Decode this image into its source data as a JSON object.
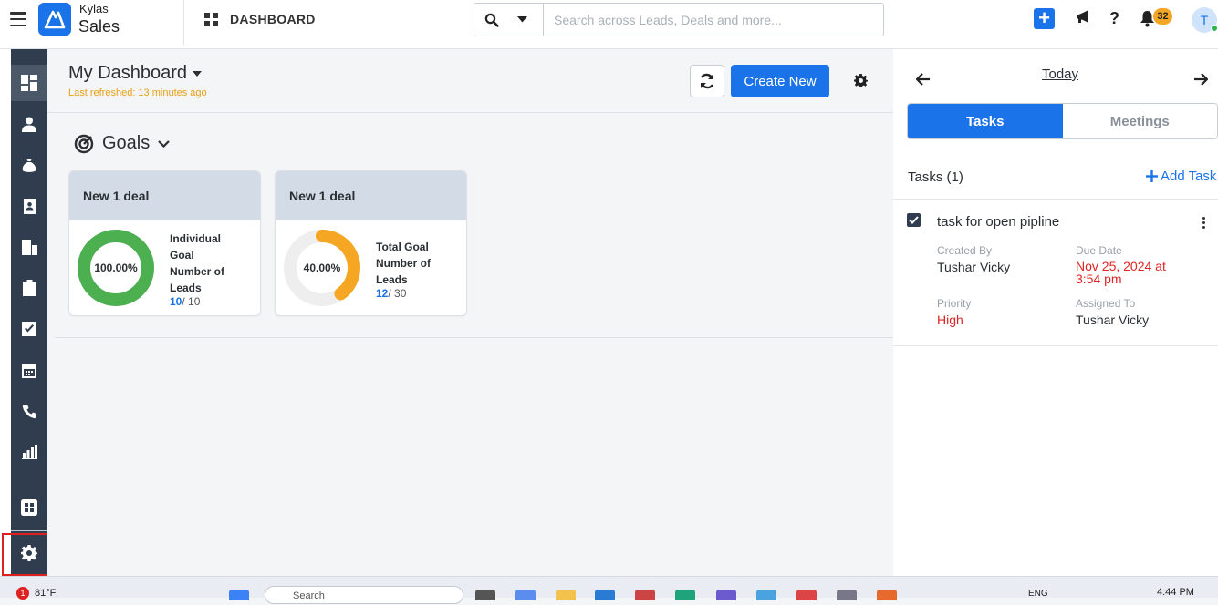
{
  "header": {
    "brand_top": "Kylas",
    "brand_bottom": "Sales",
    "section_title": "DASHBOARD",
    "search_placeholder": "Search across Leads, Deals and more...",
    "notification_count": "32",
    "avatar_initial": "T"
  },
  "sidebar": {
    "items": [
      "dashboard",
      "leads",
      "deals",
      "contacts",
      "companies",
      "quotations",
      "tasks",
      "calendar",
      "calls",
      "reports",
      "apps",
      "settings"
    ],
    "active": "dashboard",
    "highlighted": "settings"
  },
  "dashboard": {
    "title": "My Dashboard",
    "last_refreshed": "Last refreshed: 13 minutes ago",
    "create_new_label": "Create New",
    "goals_label": "Goals",
    "cards": [
      {
        "header": "New 1 deal",
        "percent": 100,
        "percent_label": "100.00%",
        "text_lines": [
          "Individual",
          "Goal",
          "Number of",
          "Leads"
        ],
        "achieved": "10",
        "target": "/ 10",
        "color": "#4caf50"
      },
      {
        "header": "New 1 deal",
        "percent": 40,
        "percent_label": "40.00%",
        "text_lines": [
          "Total Goal",
          "Number of",
          "Leads"
        ],
        "achieved": "12",
        "target": "/ 30",
        "color": "#f5a623"
      }
    ]
  },
  "right_panel": {
    "date_label": "Today",
    "tabs": [
      "Tasks",
      "Meetings"
    ],
    "active_tab": "Tasks",
    "tasks_count_label": "Tasks (1)",
    "add_task_label": "Add Task",
    "task": {
      "name": "task for open pipline",
      "created_by_label": "Created By",
      "created_by": "Tushar Vicky",
      "due_date_label": "Due Date",
      "due_date_line1": "Nov 25, 2024 at",
      "due_date_line2": "3:54 pm",
      "priority_label": "Priority",
      "priority": "High",
      "assigned_to_label": "Assigned To",
      "assigned_to": "Tushar Vicky"
    }
  },
  "taskbar": {
    "weather_alert": "1",
    "temperature": "81°F",
    "search_text": "Search",
    "language": "ENG",
    "time": "4:44 PM"
  },
  "colors": {
    "accent": "#1a73e8",
    "sidebar": "#2f3d4f",
    "warning": "#e8a013",
    "danger": "#e02424",
    "success": "#4caf50"
  }
}
